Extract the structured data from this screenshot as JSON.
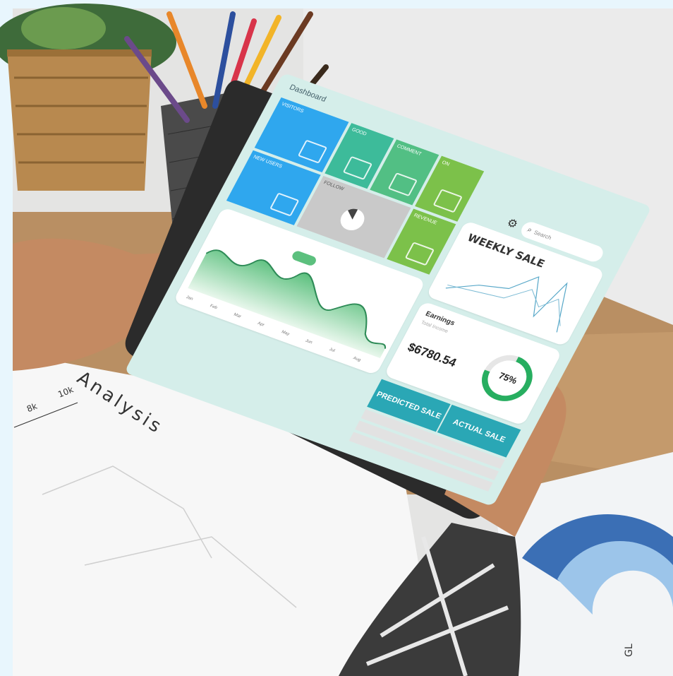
{
  "photo": {
    "description_tags": [
      "tablet",
      "hands",
      "desk",
      "pencils",
      "plant",
      "report-papers"
    ],
    "colors": {
      "background": "#e8f6fd",
      "wall": "#e7e7e7",
      "desk": "#b98f63",
      "tile_blue": "#2fa7ee",
      "tile_teal": "#3dbb9a",
      "tile_green": "#7cc14a",
      "accent_green": "#27ae60",
      "table_header": "#2aa7b5"
    }
  },
  "dashboard": {
    "title": "Dashboard",
    "search_placeholder": "Search",
    "tiles": [
      {
        "label": "VISITORS",
        "icon": "monitor-chart-icon"
      },
      {
        "label": "NEW USERS",
        "icon": "growth-chart-icon"
      },
      {
        "label": "GOOD",
        "icon": "badge-icon"
      },
      {
        "label": "COMMENT",
        "icon": "chat-icon"
      },
      {
        "label": "ON",
        "icon": "document-icon"
      },
      {
        "label": "FOLLOW",
        "icon": "pie-icon"
      },
      {
        "label": "REVENUE",
        "icon": "money-bag-icon"
      }
    ],
    "weekly_sale": {
      "title": "WEEKLY SALE"
    },
    "earnings": {
      "title": "Earnings",
      "subtitle": "Total Income",
      "amount": "$6780.54",
      "progress_label": "75%",
      "progress": 0.75
    },
    "table": {
      "predicted": "PREDICTED SALE",
      "actual": "ACTUAL SALE"
    },
    "area_chart_months": [
      "Jan",
      "Feb",
      "Mar",
      "Apr",
      "May",
      "Jun",
      "Jul",
      "Aug"
    ]
  },
  "paper": {
    "heading": "Analysis",
    "tick_10k": "10k",
    "tick_8k": "8k"
  },
  "watermark": "GL"
}
